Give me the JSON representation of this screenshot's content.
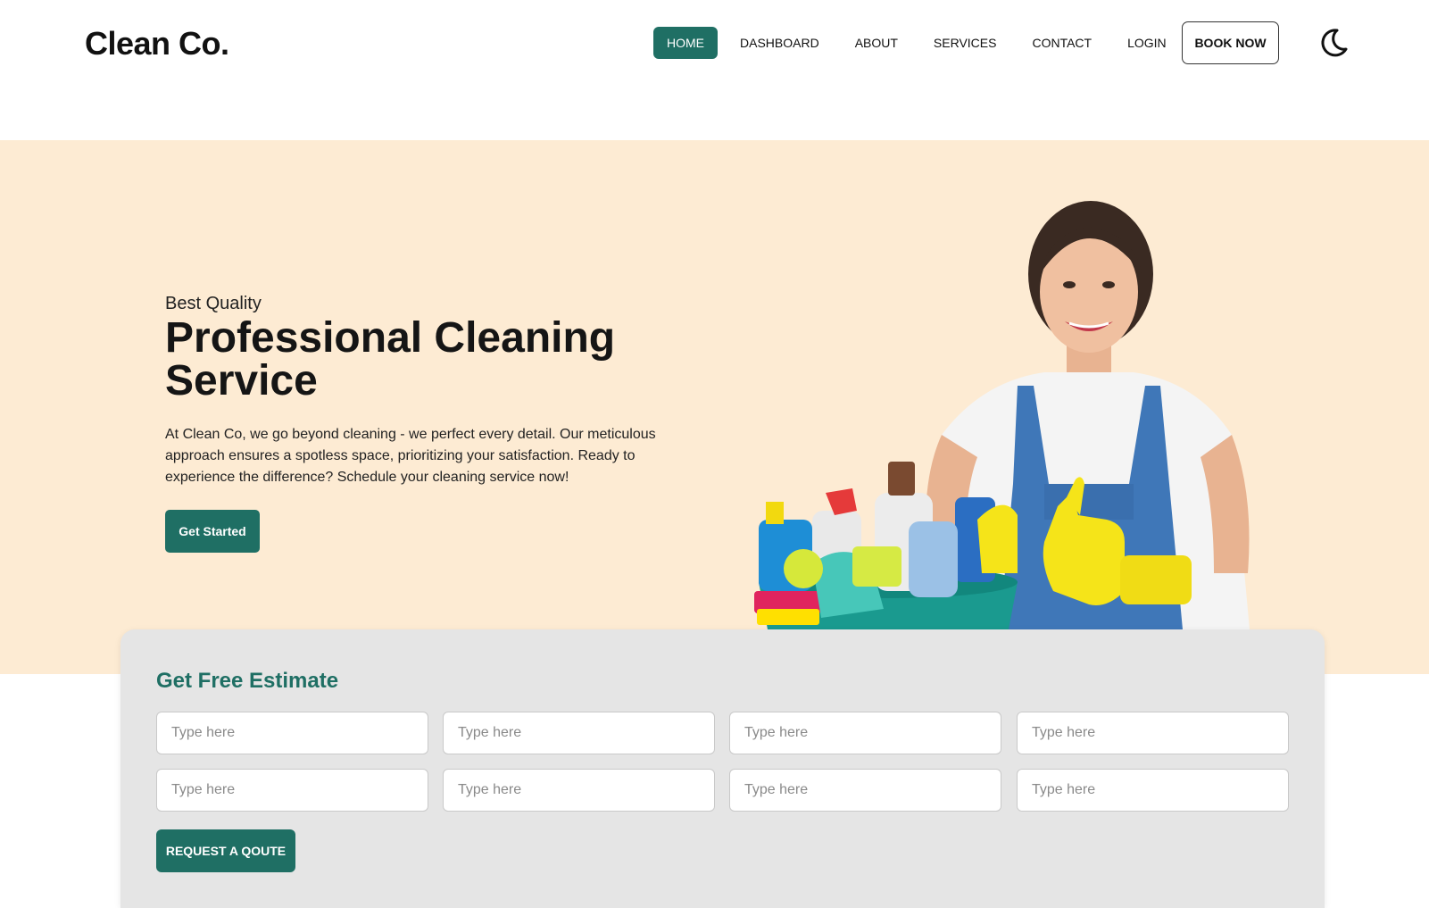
{
  "brand": {
    "logo_text": "Clean Co."
  },
  "nav": {
    "items": [
      {
        "label": "HOME",
        "active": true
      },
      {
        "label": "DASHBOARD",
        "active": false
      },
      {
        "label": "ABOUT",
        "active": false
      },
      {
        "label": "SERVICES",
        "active": false
      },
      {
        "label": "CONTACT",
        "active": false
      },
      {
        "label": "LOGIN",
        "active": false
      }
    ],
    "book_now_label": "BOOK NOW",
    "theme_toggle_icon": "moon-icon"
  },
  "hero": {
    "subtitle": "Best Quality",
    "title": "Professional Cleaning Service",
    "description": "At Clean Co, we go beyond cleaning - we perfect every detail. Our meticulous approach ensures a spotless space, prioritizing your satisfaction. Ready to experience the difference? Schedule your cleaning service now!",
    "cta_label": "Get Started"
  },
  "estimate": {
    "title": "Get Free Estimate",
    "field_placeholder": "Type here",
    "fields": [
      {
        "value": "",
        "placeholder": "Type here"
      },
      {
        "value": "",
        "placeholder": "Type here"
      },
      {
        "value": "",
        "placeholder": "Type here"
      },
      {
        "value": "",
        "placeholder": "Type here"
      },
      {
        "value": "",
        "placeholder": "Type here"
      },
      {
        "value": "",
        "placeholder": "Type here"
      },
      {
        "value": "",
        "placeholder": "Type here"
      },
      {
        "value": "",
        "placeholder": "Type here"
      }
    ],
    "submit_label": "REQUEST A QOUTE"
  },
  "colors": {
    "accent": "#1f6f64",
    "hero_background": "#fdebd3",
    "card_background": "#e5e5e5"
  }
}
